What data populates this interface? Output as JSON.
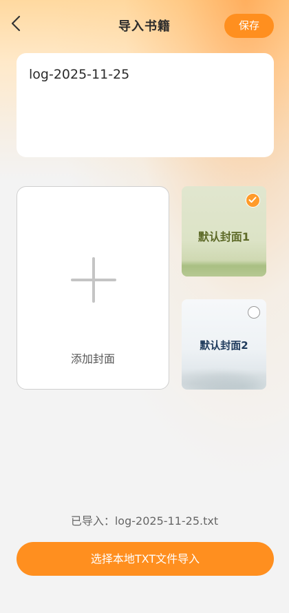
{
  "header": {
    "title": "导入书籍",
    "save_label": "保存",
    "back_icon": "chevron-left-icon"
  },
  "book_title_input": {
    "value": "log-2025-11-25"
  },
  "cover_picker": {
    "add_label": "添加封面",
    "add_icon": "plus-icon",
    "defaults": [
      {
        "label": "默认封面1",
        "selected": true
      },
      {
        "label": "默认封面2",
        "selected": false
      }
    ]
  },
  "import": {
    "status_text": "已导入：log-2025-11-25.txt",
    "button_label": "选择本地TXT文件导入"
  },
  "colors": {
    "accent": "#ff8f1f",
    "check": "#ff9a2a"
  }
}
